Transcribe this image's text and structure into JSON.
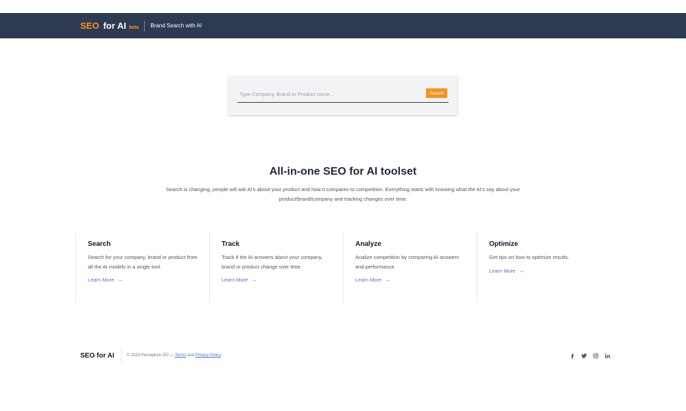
{
  "navbar": {
    "brand_seo": "SEO",
    "brand_for_ai": "for AI",
    "brand_beta": "beta",
    "subtitle": "Brand Search with AI"
  },
  "search": {
    "placeholder": "Type Company, Brand or Product name...",
    "value": "",
    "button_label": "Search"
  },
  "hero": {
    "title": "All-in-one SEO for AI toolset",
    "text": "Search is changing, people will ask AI's about your product and how it compares to competition. Everything starts with knowing what the AI's say about your product/brand/company and tracking changes over time."
  },
  "features": [
    {
      "title": "Search",
      "text": "Search for your company, brand or product from all the AI models in a single tool.",
      "link": "Learn More"
    },
    {
      "title": "Track",
      "text": "Track if the AI answers about your company, brand or product change over time.",
      "link": "Learn More"
    },
    {
      "title": "Analyze",
      "text": "Analize competition by comparing AI answers and performance.",
      "link": "Learn More"
    },
    {
      "title": "Optimize",
      "text": "Get tips on how to optimize results.",
      "link": "Learn More"
    }
  ],
  "footer": {
    "brand": "SEO for AI",
    "copyright": "© 2023 Perceptron OÜ — ",
    "terms": "Terms",
    "and": " and ",
    "privacy": "Privacy Policy",
    "period": ".",
    "socials": [
      "facebook-icon",
      "twitter-icon",
      "instagram-icon",
      "linkedin-icon"
    ]
  },
  "colors": {
    "navbar_bg": "#2d3a52",
    "accent": "#f7931e",
    "link": "#6b65c9"
  }
}
